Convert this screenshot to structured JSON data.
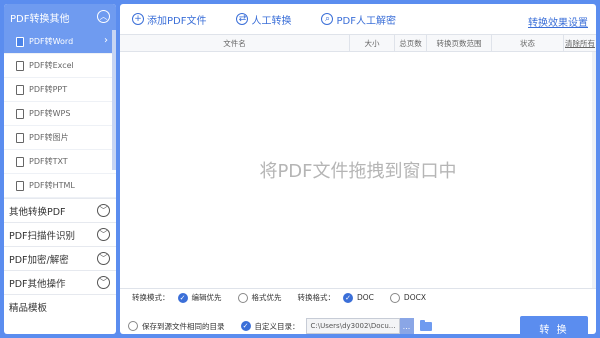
{
  "sidebar": {
    "header": "PDF转换其他",
    "header_icon": "chevron-up",
    "sub_items": [
      {
        "label": "PDF转Word",
        "active": true
      },
      {
        "label": "PDF转Excel"
      },
      {
        "label": "PDF转PPT"
      },
      {
        "label": "PDF转WPS"
      },
      {
        "label": "PDF转图片"
      },
      {
        "label": "PDF转TXT"
      },
      {
        "label": "PDF转HTML"
      }
    ],
    "categories": [
      {
        "label": "其他转换PDF"
      },
      {
        "label": "PDF扫描件识别"
      },
      {
        "label": "PDF加密/解密"
      },
      {
        "label": "PDF其他操作"
      },
      {
        "label": "精品模板"
      }
    ]
  },
  "toolbar": {
    "add_file": "添加PDF文件",
    "manual": "人工转换",
    "decrypt": "PDF人工解密",
    "settings_link": "转换效果设置"
  },
  "table": {
    "columns": [
      "文件名",
      "大小",
      "总页数",
      "转换页数范围",
      "状态",
      "清除所有"
    ]
  },
  "drop_hint": "将PDF文件拖拽到窗口中",
  "options": {
    "mode_label": "转换模式：",
    "mode_edit": "编辑优先",
    "mode_format": "格式优先",
    "format_label": "转换格式：",
    "format_doc": "DOC",
    "format_docx": "DOCX",
    "save_same": "保存到源文件相同的目录",
    "custom_dir": "自定义目录：",
    "path_value": "C:\\Users\\dy3002\\Docu...",
    "browse": "...",
    "convert": "转 换"
  },
  "colors": {
    "accent": "#5b8def",
    "link": "#3b6fd8"
  }
}
